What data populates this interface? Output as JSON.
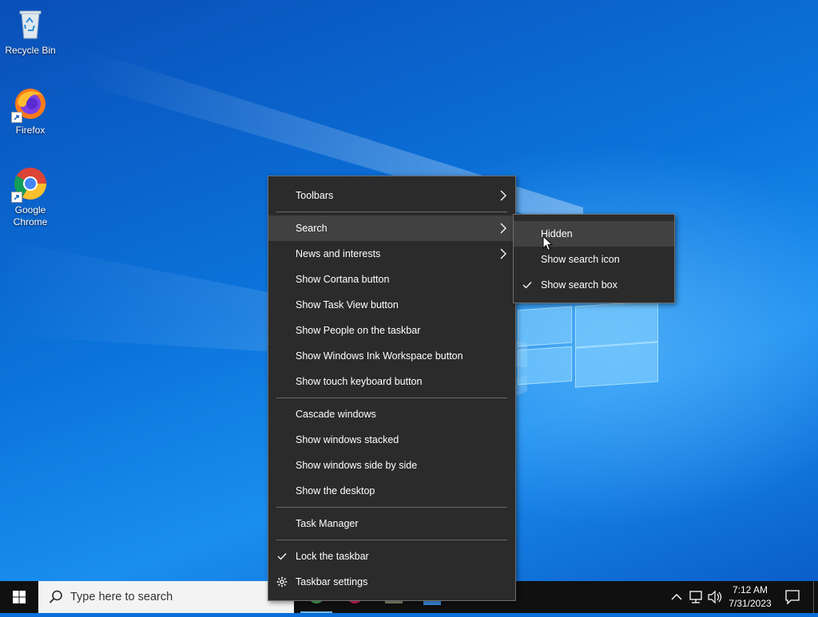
{
  "desktop": {
    "icons": [
      {
        "label": "Recycle Bin"
      },
      {
        "label": "Firefox"
      },
      {
        "label": "Google Chrome"
      }
    ]
  },
  "context_menu": {
    "items": [
      {
        "label": "Toolbars",
        "submenu": true
      },
      {
        "label": "Search",
        "submenu": true,
        "highlighted": true
      },
      {
        "label": "News and interests",
        "submenu": true
      },
      {
        "label": "Show Cortana button"
      },
      {
        "label": "Show Task View button"
      },
      {
        "label": "Show People on the taskbar"
      },
      {
        "label": "Show Windows Ink Workspace button"
      },
      {
        "label": "Show touch keyboard button"
      },
      {
        "label": "Cascade windows"
      },
      {
        "label": "Show windows stacked"
      },
      {
        "label": "Show windows side by side"
      },
      {
        "label": "Show the desktop"
      },
      {
        "label": "Task Manager"
      },
      {
        "label": "Lock the taskbar",
        "checked": true
      },
      {
        "label": "Taskbar settings",
        "icon": "gear-icon"
      }
    ]
  },
  "search_submenu": {
    "items": [
      {
        "label": "Hidden",
        "highlighted": true
      },
      {
        "label": "Show search icon"
      },
      {
        "label": "Show search box",
        "checked": true
      }
    ]
  },
  "taskbar": {
    "search_placeholder": "Type here to search",
    "clock_time": "7:12 AM",
    "clock_date": "7/31/2023"
  },
  "colors": {
    "menu_bg": "#2b2b2b",
    "menu_highlight": "#414141",
    "taskbar_bg": "#101010",
    "desktop_blue": "#0b74dc"
  }
}
